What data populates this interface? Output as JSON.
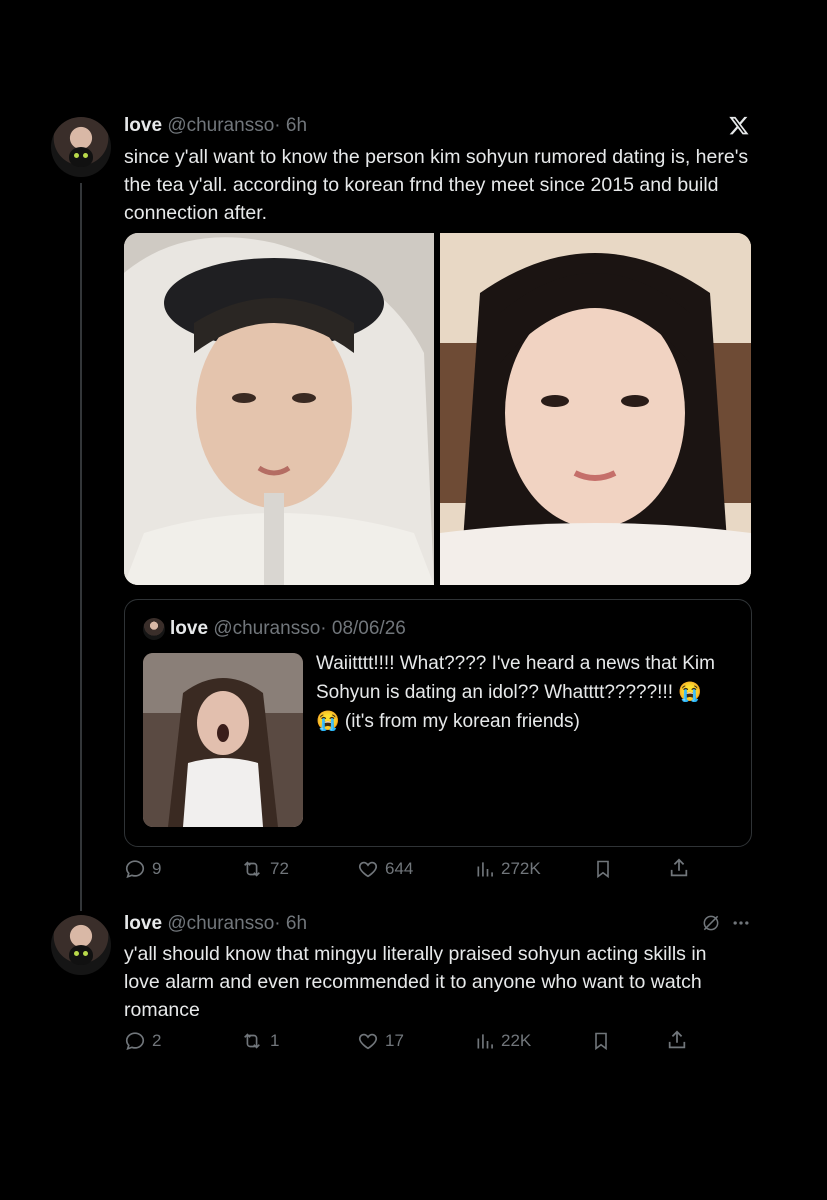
{
  "tweet1": {
    "name": "love",
    "handle": "@churansso",
    "time": "· 6h",
    "text": "since y'all want to know the person kim sohyun rumored dating is, here's the tea y'all. according to korean frnd they meet since 2015 and build connection after.",
    "quote": {
      "name": "love",
      "handle": "@churansso",
      "date": "· 08/06/26",
      "text": "Waiitttt!!!! What???? I've heard a news that Kim Sohyun is dating an idol?? Whatttt?????!!! 😭 😭 (it's from my korean friends)"
    },
    "actions": {
      "replies": "9",
      "retweets": "72",
      "likes": "644",
      "views": "272K"
    }
  },
  "tweet2": {
    "name": "love",
    "handle": "@churansso",
    "time": "· 6h",
    "text": "y'all should know that mingyu literally praised sohyun acting skills in love alarm and even recommended it to anyone who want to watch romance",
    "actions": {
      "replies": "2",
      "retweets": "1",
      "likes": "17",
      "views": "22K"
    }
  },
  "icons": {
    "logo": "x-logo-icon",
    "reply": "reply-icon",
    "retweet": "retweet-icon",
    "like": "heart-icon",
    "views": "views-icon",
    "bookmark": "bookmark-icon",
    "share": "share-icon",
    "grok": "grok-icon",
    "more": "more-icon"
  },
  "colors": {
    "background": "#000000",
    "text": "#e7e9ea",
    "muted": "#71767b",
    "border": "#2f3336"
  }
}
